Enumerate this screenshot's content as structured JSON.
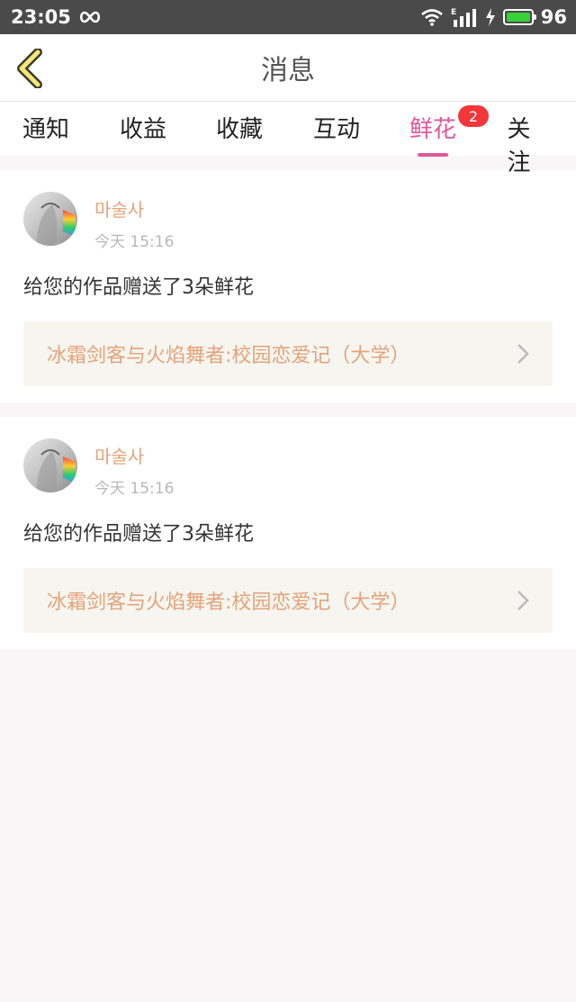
{
  "status": {
    "time": "23:05",
    "battery": "96"
  },
  "header": {
    "title": "消息"
  },
  "tabs": [
    {
      "label": "通知"
    },
    {
      "label": "收益"
    },
    {
      "label": "收藏"
    },
    {
      "label": "互动"
    },
    {
      "label": "鲜花",
      "badge": "2",
      "active": true
    },
    {
      "label": "关注"
    }
  ],
  "items": [
    {
      "name": "마술사",
      "time": "今天 15:16",
      "message": "给您的作品赠送了3朵鲜花",
      "work": "冰霜剑客与火焰舞者:校园恋爱记（大学）"
    },
    {
      "name": "마술사",
      "time": "今天 15:16",
      "message": "给您的作品赠送了3朵鲜花",
      "work": "冰霜剑客与火焰舞者:校园恋爱记（大学）"
    }
  ],
  "colors": {
    "accent": "#e0579a",
    "name": "#e4a37a",
    "badge": "#f2363a"
  }
}
